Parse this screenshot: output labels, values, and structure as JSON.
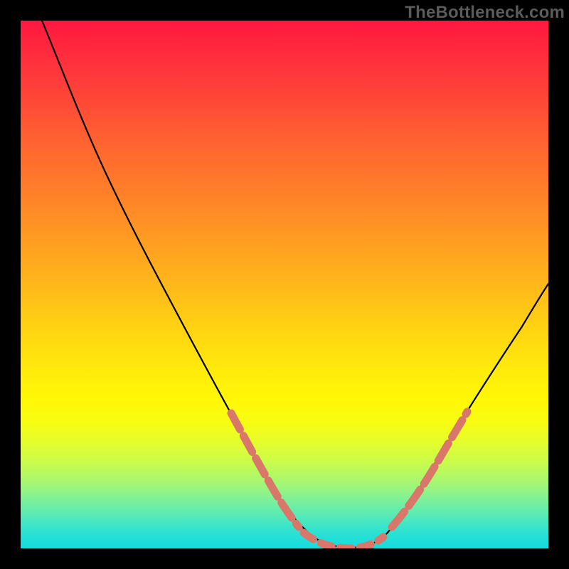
{
  "watermark": "TheBottleneck.com",
  "chart_data": {
    "type": "line",
    "title": "",
    "xlabel": "",
    "ylabel": "",
    "xlim": [
      0,
      100
    ],
    "ylim": [
      0,
      100
    ],
    "grid": false,
    "legend_position": "none",
    "series": [
      {
        "name": "bottleneck-curve",
        "color": "#000000",
        "x": [
          4,
          8,
          12,
          16,
          20,
          24,
          28,
          32,
          36,
          40,
          44,
          48,
          50,
          52,
          54,
          56,
          58,
          60,
          62,
          64,
          66,
          68,
          72,
          76,
          80,
          84,
          88,
          92,
          96,
          100
        ],
        "y": [
          100,
          94,
          86,
          78,
          70,
          62,
          53,
          45,
          37,
          30,
          23,
          16,
          13,
          10,
          7,
          5,
          3,
          2,
          1,
          1,
          2,
          4,
          9,
          15,
          22,
          29,
          36,
          43,
          51,
          58
        ]
      },
      {
        "name": "highlight-segments-salmon",
        "color": "#d8776a",
        "segments": [
          {
            "x": [
              36,
              40,
              44,
              48,
              50
            ],
            "y": [
              37,
              30,
              23,
              16,
              13
            ]
          },
          {
            "x": [
              52,
              54,
              56,
              58,
              60,
              62,
              64,
              66,
              68
            ],
            "y": [
              10,
              7,
              5,
              3,
              2,
              1,
              1,
              2,
              4
            ]
          },
          {
            "x": [
              72,
              76,
              80,
              84
            ],
            "y": [
              9,
              15,
              22,
              29
            ]
          }
        ]
      }
    ]
  }
}
